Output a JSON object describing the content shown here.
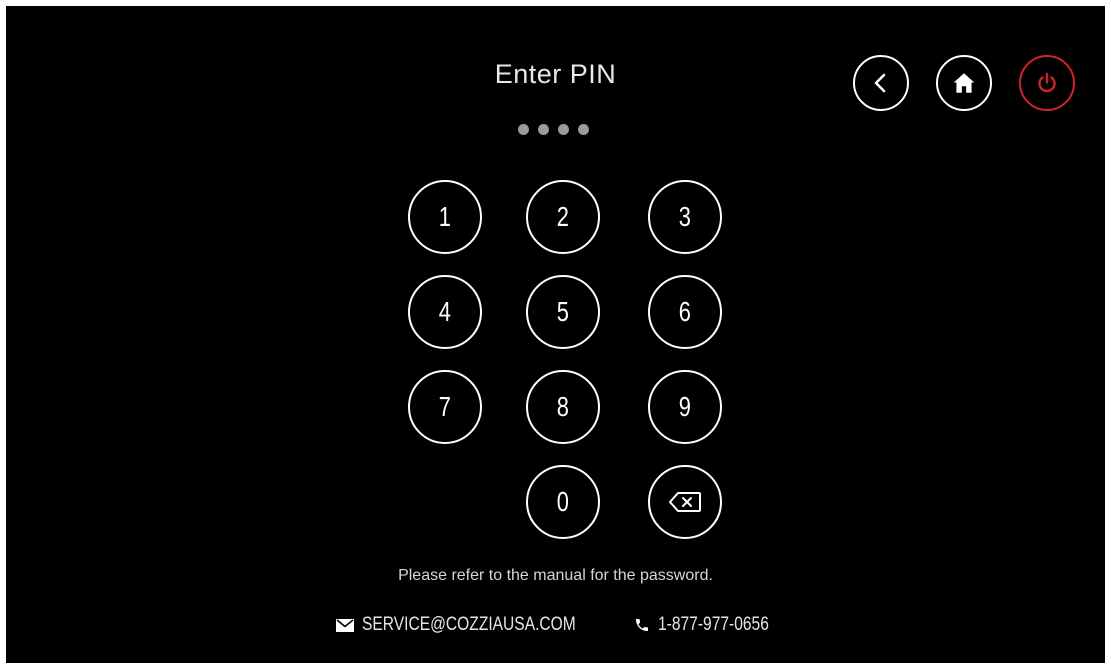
{
  "header": {
    "title": "Enter PIN",
    "pin_length_entered": 4
  },
  "nav": {
    "back_icon": "chevron-left-icon",
    "home_icon": "home-icon",
    "power_icon": "power-icon",
    "power_color": "#d3232a"
  },
  "keypad": {
    "keys": [
      "1",
      "2",
      "3",
      "4",
      "5",
      "6",
      "7",
      "8",
      "9",
      "0"
    ],
    "backspace_icon": "backspace-icon"
  },
  "footer": {
    "note": "Please refer to the manual for the password.",
    "email": "SERVICE@COZZIAUSA.COM",
    "phone": "1-877-977-0656",
    "email_icon": "envelope-icon",
    "phone_icon": "phone-icon"
  }
}
